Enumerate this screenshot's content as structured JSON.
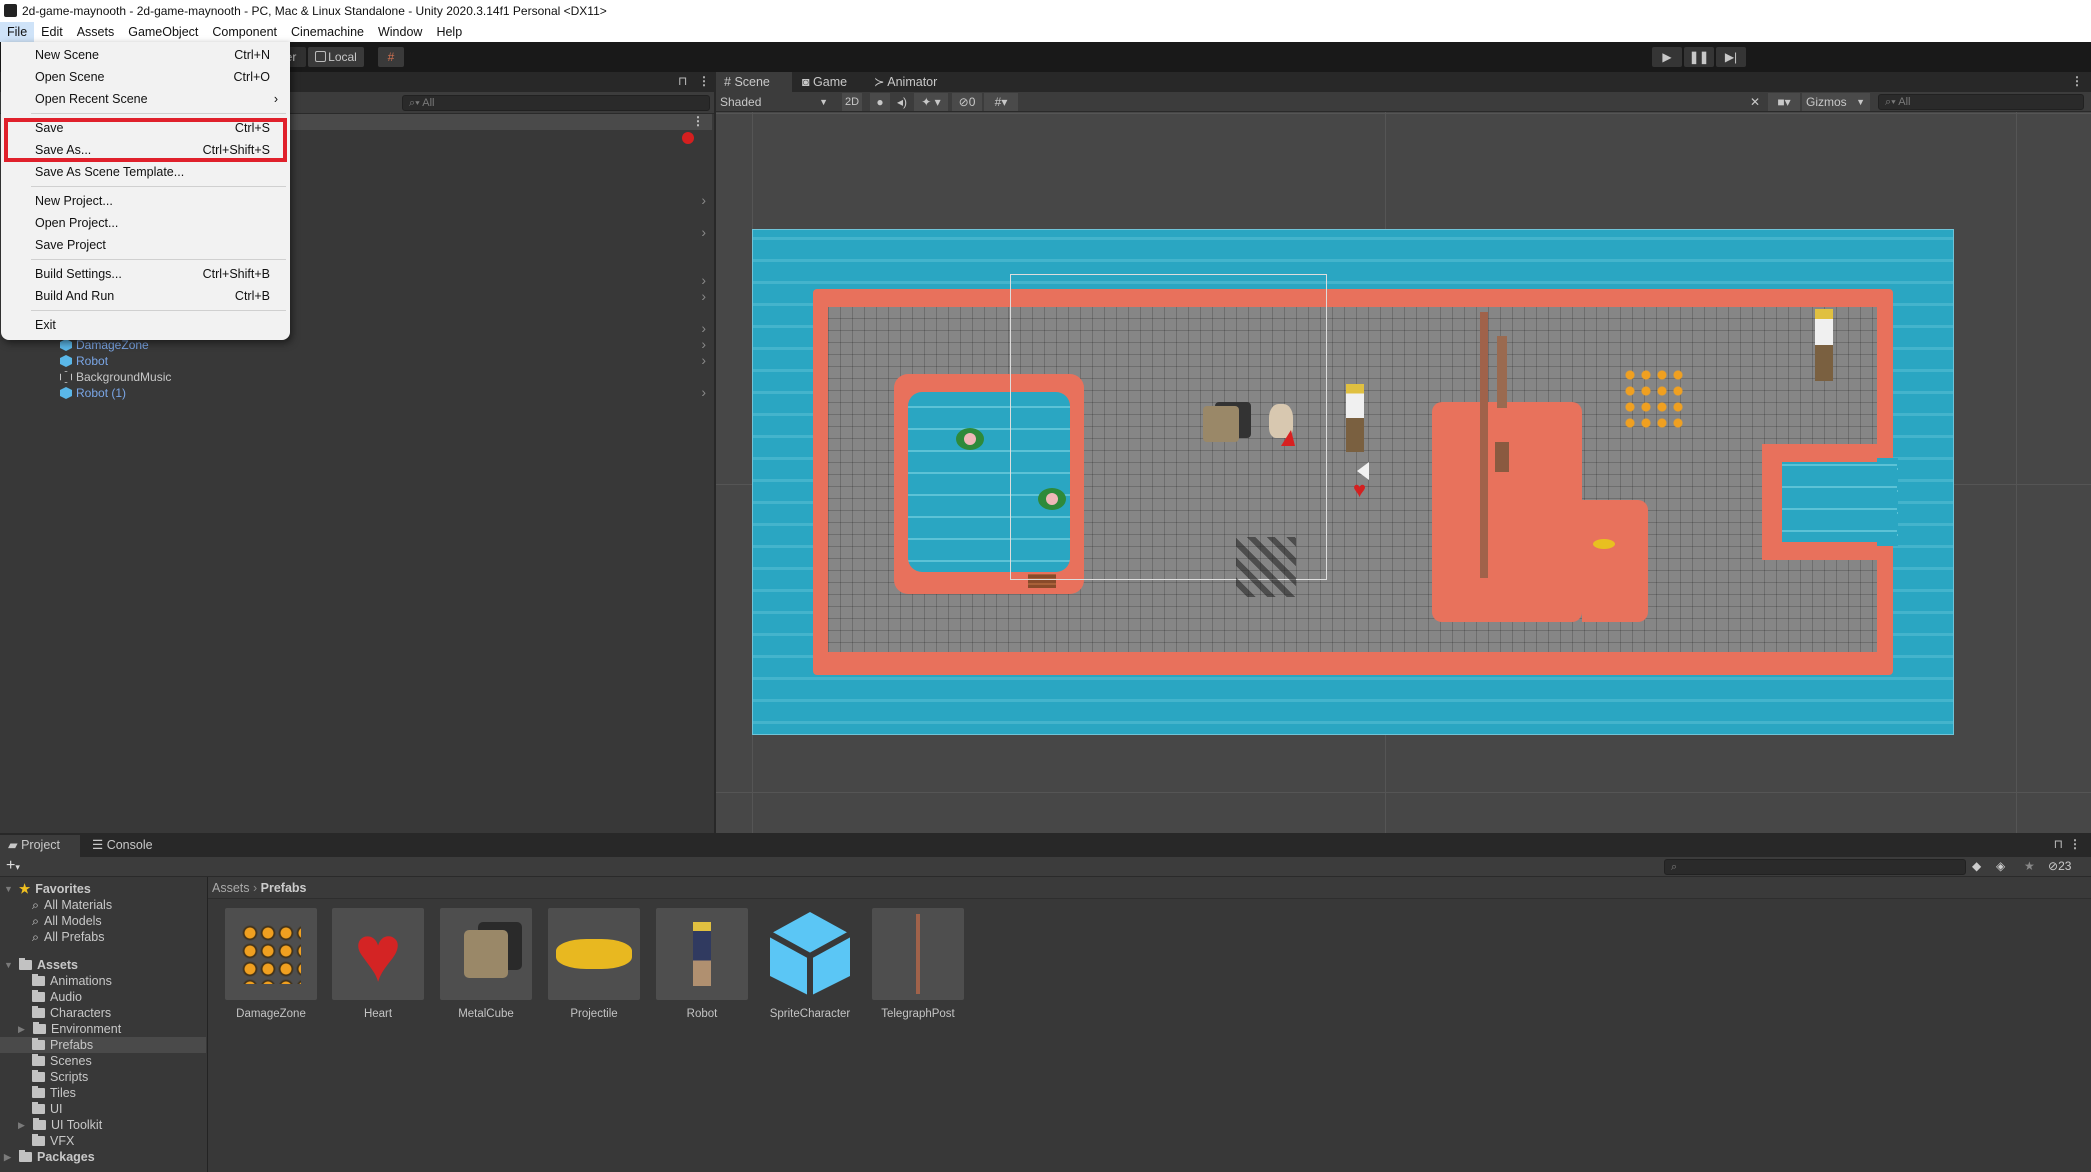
{
  "window": {
    "title": "2d-game-maynooth - 2d-game-maynooth - PC, Mac & Linux Standalone - Unity 2020.3.14f1 Personal <DX11>"
  },
  "menubar": {
    "items": [
      "File",
      "Edit",
      "Assets",
      "GameObject",
      "Component",
      "Cinemachine",
      "Window",
      "Help"
    ]
  },
  "toolbar": {
    "pivot_partial": "er",
    "space_label": "Local",
    "play_controls": [
      "play-icon",
      "pause-icon",
      "step-icon"
    ]
  },
  "file_menu": {
    "items": [
      {
        "label": "New Scene",
        "shortcut": "Ctrl+N"
      },
      {
        "label": "Open Scene",
        "shortcut": "Ctrl+O"
      },
      {
        "label": "Open Recent Scene",
        "shortcut": "›"
      },
      {
        "label": "Save",
        "shortcut": "Ctrl+S"
      },
      {
        "label": "Save As...",
        "shortcut": "Ctrl+Shift+S"
      },
      {
        "label": "Save As Scene Template...",
        "shortcut": ""
      },
      {
        "label": "New Project...",
        "shortcut": ""
      },
      {
        "label": "Open Project...",
        "shortcut": ""
      },
      {
        "label": "Save Project",
        "shortcut": ""
      },
      {
        "label": "Build Settings...",
        "shortcut": "Ctrl+Shift+B"
      },
      {
        "label": "Build And Run",
        "shortcut": "Ctrl+B"
      },
      {
        "label": "Exit",
        "shortcut": ""
      }
    ],
    "highlight_color": "#e0202b"
  },
  "hierarchy": {
    "search_placeholder": "All",
    "items": [
      {
        "label": "DamageZone",
        "type": "prefab"
      },
      {
        "label": "Robot",
        "type": "prefab"
      },
      {
        "label": "BackgroundMusic",
        "type": "object"
      },
      {
        "label": "Robot (1)",
        "type": "prefab"
      }
    ]
  },
  "scene": {
    "tabs": [
      "Scene",
      "Game",
      "Animator"
    ],
    "draw_mode": "Shaded",
    "mode_2d": "2D",
    "hidden_count": "0",
    "gizmos_label": "Gizmos",
    "search_placeholder": "All"
  },
  "project": {
    "tabs": [
      "Project",
      "Console"
    ],
    "breadcrumb": [
      "Assets",
      "Prefabs"
    ],
    "hidden_count": "23",
    "favorites": {
      "label": "Favorites",
      "items": [
        "All Materials",
        "All Models",
        "All Prefabs"
      ]
    },
    "assets": {
      "label": "Assets",
      "folders": [
        "Animations",
        "Audio",
        "Characters",
        "Environment",
        "Prefabs",
        "Scenes",
        "Scripts",
        "Tiles",
        "UI",
        "UI Toolkit",
        "VFX"
      ]
    },
    "packages": "Packages",
    "selected_folder": "Prefabs",
    "grid_items": [
      "DamageZone",
      "Heart",
      "MetalCube",
      "Projectile",
      "Robot",
      "SpriteCharacter",
      "TelegraphPost"
    ]
  }
}
